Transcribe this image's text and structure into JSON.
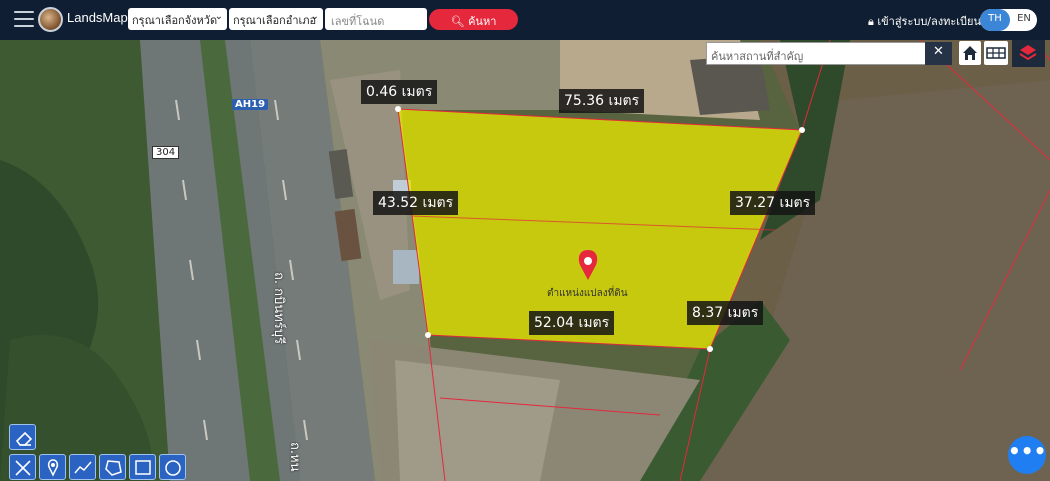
{
  "header": {
    "brand": "LandsMaps",
    "province_select": "กรุณาเลือกจังหวัด",
    "district_select": "กรุณาเลือกอำเภอ",
    "deed_placeholder": "เลขที่โฉนด",
    "search_label": "ค้นหา",
    "login_label": "เข้าสู่ระบบ/ลงทะเบียน",
    "lang_th": "TH",
    "lang_en": "EN"
  },
  "map": {
    "place_search_placeholder": "ค้นหาสถานที่สำคัญ",
    "close_symbol": "✕",
    "road_label_304": "304",
    "road_label_ah": "AH19",
    "street_name_1": "ถ. กบินทร์บุรี",
    "street_name_2": "ถ.หน",
    "pin_label": "ตำแหน่งแปลงที่ดิน",
    "dimensions": {
      "top_left": "0.46 เมตร",
      "top": "75.36 เมตร",
      "left": "43.52 เมตร",
      "right": "37.27 เมตร",
      "bottom": "52.04 เมตร",
      "bottom_right": "8.37 เมตร"
    },
    "fab_symbol": "•••"
  },
  "tools": {
    "icons": [
      "eraser-icon",
      "measure-icon",
      "marker-icon",
      "polyline-icon",
      "polygon-icon",
      "rectangle-icon",
      "circle-icon"
    ]
  },
  "colors": {
    "header_bg": "#0f1e33",
    "search_button": "#e5283c",
    "parcel_fill": "#e6e600",
    "parcel_border": "#e5283c",
    "tool_bg": "#2b63c2",
    "fab": "#1f7ff2"
  }
}
